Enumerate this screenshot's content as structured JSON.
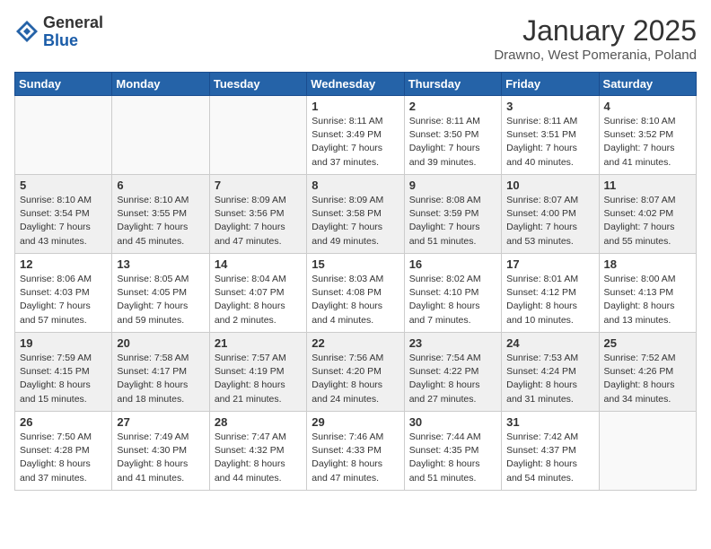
{
  "logo": {
    "general": "General",
    "blue": "Blue"
  },
  "header": {
    "month": "January 2025",
    "location": "Drawno, West Pomerania, Poland"
  },
  "weekdays": [
    "Sunday",
    "Monday",
    "Tuesday",
    "Wednesday",
    "Thursday",
    "Friday",
    "Saturday"
  ],
  "weeks": [
    {
      "shaded": false,
      "days": [
        {
          "number": "",
          "text": ""
        },
        {
          "number": "",
          "text": ""
        },
        {
          "number": "",
          "text": ""
        },
        {
          "number": "1",
          "text": "Sunrise: 8:11 AM\nSunset: 3:49 PM\nDaylight: 7 hours\nand 37 minutes."
        },
        {
          "number": "2",
          "text": "Sunrise: 8:11 AM\nSunset: 3:50 PM\nDaylight: 7 hours\nand 39 minutes."
        },
        {
          "number": "3",
          "text": "Sunrise: 8:11 AM\nSunset: 3:51 PM\nDaylight: 7 hours\nand 40 minutes."
        },
        {
          "number": "4",
          "text": "Sunrise: 8:10 AM\nSunset: 3:52 PM\nDaylight: 7 hours\nand 41 minutes."
        }
      ]
    },
    {
      "shaded": true,
      "days": [
        {
          "number": "5",
          "text": "Sunrise: 8:10 AM\nSunset: 3:54 PM\nDaylight: 7 hours\nand 43 minutes."
        },
        {
          "number": "6",
          "text": "Sunrise: 8:10 AM\nSunset: 3:55 PM\nDaylight: 7 hours\nand 45 minutes."
        },
        {
          "number": "7",
          "text": "Sunrise: 8:09 AM\nSunset: 3:56 PM\nDaylight: 7 hours\nand 47 minutes."
        },
        {
          "number": "8",
          "text": "Sunrise: 8:09 AM\nSunset: 3:58 PM\nDaylight: 7 hours\nand 49 minutes."
        },
        {
          "number": "9",
          "text": "Sunrise: 8:08 AM\nSunset: 3:59 PM\nDaylight: 7 hours\nand 51 minutes."
        },
        {
          "number": "10",
          "text": "Sunrise: 8:07 AM\nSunset: 4:00 PM\nDaylight: 7 hours\nand 53 minutes."
        },
        {
          "number": "11",
          "text": "Sunrise: 8:07 AM\nSunset: 4:02 PM\nDaylight: 7 hours\nand 55 minutes."
        }
      ]
    },
    {
      "shaded": false,
      "days": [
        {
          "number": "12",
          "text": "Sunrise: 8:06 AM\nSunset: 4:03 PM\nDaylight: 7 hours\nand 57 minutes."
        },
        {
          "number": "13",
          "text": "Sunrise: 8:05 AM\nSunset: 4:05 PM\nDaylight: 7 hours\nand 59 minutes."
        },
        {
          "number": "14",
          "text": "Sunrise: 8:04 AM\nSunset: 4:07 PM\nDaylight: 8 hours\nand 2 minutes."
        },
        {
          "number": "15",
          "text": "Sunrise: 8:03 AM\nSunset: 4:08 PM\nDaylight: 8 hours\nand 4 minutes."
        },
        {
          "number": "16",
          "text": "Sunrise: 8:02 AM\nSunset: 4:10 PM\nDaylight: 8 hours\nand 7 minutes."
        },
        {
          "number": "17",
          "text": "Sunrise: 8:01 AM\nSunset: 4:12 PM\nDaylight: 8 hours\nand 10 minutes."
        },
        {
          "number": "18",
          "text": "Sunrise: 8:00 AM\nSunset: 4:13 PM\nDaylight: 8 hours\nand 13 minutes."
        }
      ]
    },
    {
      "shaded": true,
      "days": [
        {
          "number": "19",
          "text": "Sunrise: 7:59 AM\nSunset: 4:15 PM\nDaylight: 8 hours\nand 15 minutes."
        },
        {
          "number": "20",
          "text": "Sunrise: 7:58 AM\nSunset: 4:17 PM\nDaylight: 8 hours\nand 18 minutes."
        },
        {
          "number": "21",
          "text": "Sunrise: 7:57 AM\nSunset: 4:19 PM\nDaylight: 8 hours\nand 21 minutes."
        },
        {
          "number": "22",
          "text": "Sunrise: 7:56 AM\nSunset: 4:20 PM\nDaylight: 8 hours\nand 24 minutes."
        },
        {
          "number": "23",
          "text": "Sunrise: 7:54 AM\nSunset: 4:22 PM\nDaylight: 8 hours\nand 27 minutes."
        },
        {
          "number": "24",
          "text": "Sunrise: 7:53 AM\nSunset: 4:24 PM\nDaylight: 8 hours\nand 31 minutes."
        },
        {
          "number": "25",
          "text": "Sunrise: 7:52 AM\nSunset: 4:26 PM\nDaylight: 8 hours\nand 34 minutes."
        }
      ]
    },
    {
      "shaded": false,
      "days": [
        {
          "number": "26",
          "text": "Sunrise: 7:50 AM\nSunset: 4:28 PM\nDaylight: 8 hours\nand 37 minutes."
        },
        {
          "number": "27",
          "text": "Sunrise: 7:49 AM\nSunset: 4:30 PM\nDaylight: 8 hours\nand 41 minutes."
        },
        {
          "number": "28",
          "text": "Sunrise: 7:47 AM\nSunset: 4:32 PM\nDaylight: 8 hours\nand 44 minutes."
        },
        {
          "number": "29",
          "text": "Sunrise: 7:46 AM\nSunset: 4:33 PM\nDaylight: 8 hours\nand 47 minutes."
        },
        {
          "number": "30",
          "text": "Sunrise: 7:44 AM\nSunset: 4:35 PM\nDaylight: 8 hours\nand 51 minutes."
        },
        {
          "number": "31",
          "text": "Sunrise: 7:42 AM\nSunset: 4:37 PM\nDaylight: 8 hours\nand 54 minutes."
        },
        {
          "number": "",
          "text": ""
        }
      ]
    }
  ]
}
